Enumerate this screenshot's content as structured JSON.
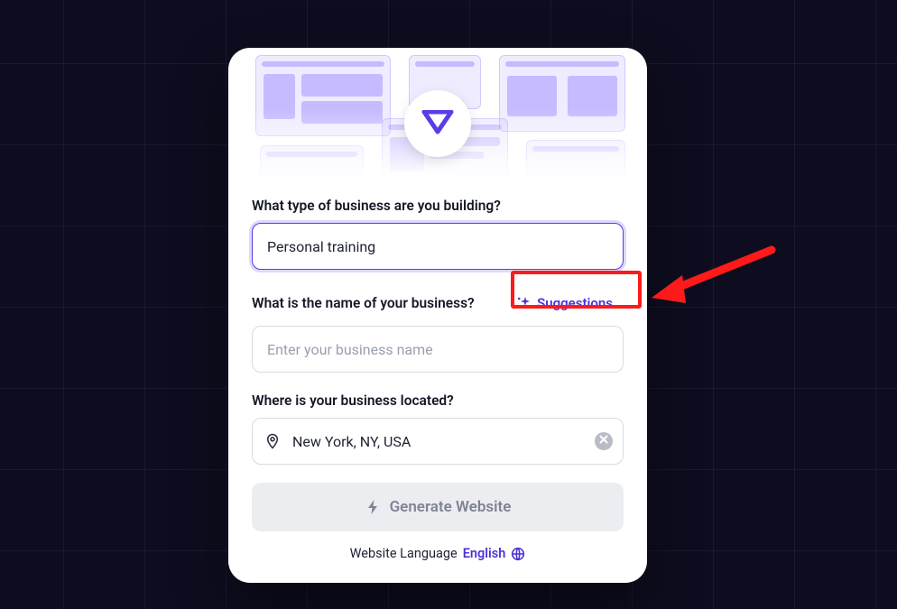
{
  "form": {
    "business_type_label": "What type of business are you building?",
    "business_type_value": "Personal training",
    "business_name_label": "What is the name of your business?",
    "business_name_value": "",
    "business_name_placeholder": "Enter your business name",
    "suggestions_label": "Suggestions",
    "location_label": "Where is your business located?",
    "location_value": "New York, NY, USA",
    "generate_label": "Generate Website"
  },
  "footer": {
    "lang_prefix": "Website Language",
    "lang_value": "English"
  },
  "colors": {
    "accent": "#5a3de6",
    "annotation": "#ff1a1a"
  }
}
